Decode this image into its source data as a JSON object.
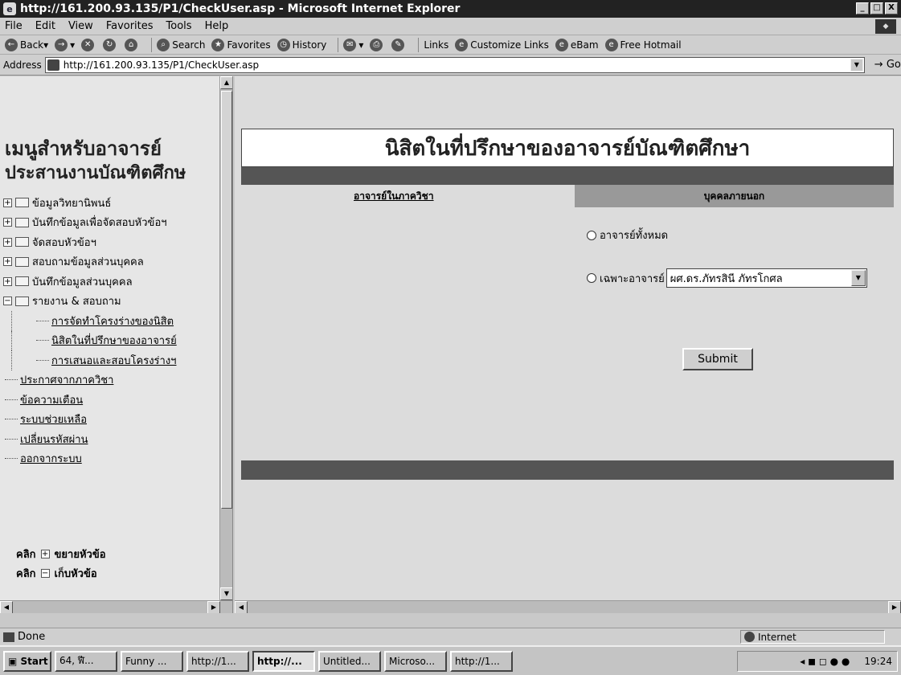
{
  "window": {
    "title": "http://161.200.93.135/P1/CheckUser.asp - Microsoft Internet Explorer",
    "icon": "ie-icon",
    "btn_min": "_",
    "btn_max": "□",
    "btn_close": "X"
  },
  "menubar": {
    "items": [
      "File",
      "Edit",
      "View",
      "Favorites",
      "Tools",
      "Help"
    ]
  },
  "toolbar": {
    "back": "Back",
    "search": "Search",
    "favorites": "Favorites",
    "history": "History",
    "links": "Links",
    "customize": "Customize Links",
    "ebam": "eBam",
    "hotmail": "Free Hotmail"
  },
  "address": {
    "label": "Address",
    "url": "http://161.200.93.135/P1/CheckUser.asp",
    "go": "Go"
  },
  "left": {
    "title1": "เมนูสำหรับอาจารย์",
    "title2": "ประสานงานบัณฑิตศึกษ",
    "tree": [
      "ข้อมูลวิทยานิพนธ์",
      "บันทึกข้อมูลเพื่อจัดสอบหัวข้อฯ",
      "จัดสอบหัวข้อฯ",
      "สอบถามข้อมูลส่วนบุคคล",
      "บันทึกข้อมูลส่วนบุคคล",
      "รายงาน & สอบถาม"
    ],
    "sub": [
      "การจัดทำโครงร่างของนิสิต",
      "นิสิตในที่ปรึกษาของอาจารย์",
      "การเสนอและสอบโครงร่างฯ"
    ],
    "links": [
      "ประกาศจากภาควิชา",
      "ข้อความเตือน",
      "ระบบช่วยเหลือ",
      "เปลี่ยนรหัสผ่าน",
      "ออกจากระบบ"
    ],
    "legend": [
      {
        "prefix": "คลิก",
        "symbol": "+",
        "text": "ขยายหัวข้อ"
      },
      {
        "prefix": "คลิก",
        "symbol": "−",
        "text": "เก็บหัวข้อ"
      }
    ]
  },
  "main": {
    "heading": "นิสิตในที่ปรึกษาของอาจารย์บัณฑิตศึกษา",
    "tab_internal": "อาจารย์ในภาควิชา",
    "tab_external": "บุคคลภายนอก",
    "radio_all": "อาจารย์ทั้งหมด",
    "radio_specific": "เฉพาะอาจารย์",
    "select_value": "ผศ.ดร.ภัทรสินี ภัทรโกศล",
    "submit": "Submit"
  },
  "status": {
    "text": "Done",
    "zone": "Internet"
  },
  "taskbar": {
    "start": "Start",
    "items": [
      "64, ฬี...",
      "Funny ...",
      "http://1...",
      "http://...",
      "Untitled...",
      "Microso...",
      "http://1..."
    ],
    "clock": "19:24"
  }
}
